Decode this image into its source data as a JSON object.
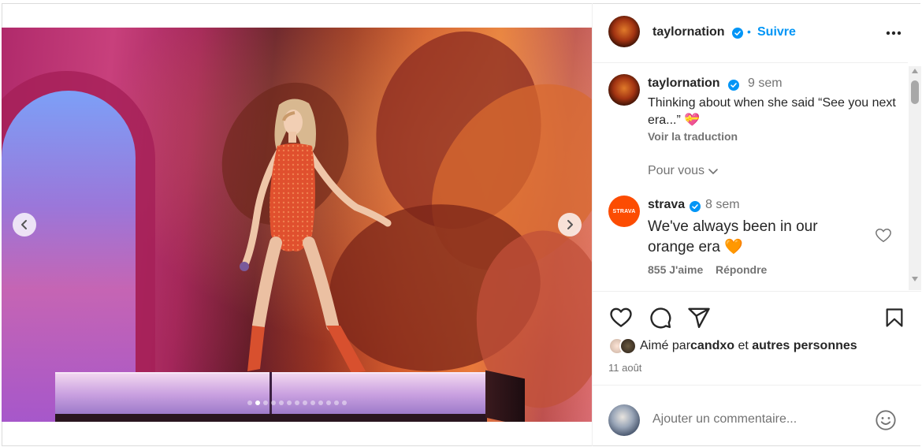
{
  "post": {
    "author": "taylornation",
    "follow_label": "Suivre",
    "bullet": "•",
    "carousel": {
      "slide_count": 13,
      "active_index": 1
    }
  },
  "caption": {
    "username": "taylornation",
    "time": "9 sem",
    "text": "Thinking about when she said “See you next era...” 💝",
    "translate_label": "Voir la traduction",
    "for_you_label": "Pour vous"
  },
  "comment": {
    "avatar_text": "STRAVA",
    "username": "strava",
    "time": "8 sem",
    "text": "We've always been in our orange era 🧡",
    "likes": "855 J'aime",
    "reply_label": "Répondre"
  },
  "likes": {
    "prefix": "Aimé par ",
    "user": "candxo",
    "middle": " et ",
    "suffix": "autres personnes"
  },
  "date": "11 août",
  "add_comment": {
    "placeholder": "Ajouter un commentaire..."
  },
  "icons": {
    "verified": "verified-badge-icon",
    "more": "more-options-icon",
    "heart": "heart-icon",
    "comment": "comment-icon",
    "share": "share-icon",
    "save": "bookmark-icon",
    "emoji": "emoji-icon"
  },
  "colors": {
    "link": "#0095f6",
    "secondary": "#737373",
    "strava": "#fc4c02"
  }
}
